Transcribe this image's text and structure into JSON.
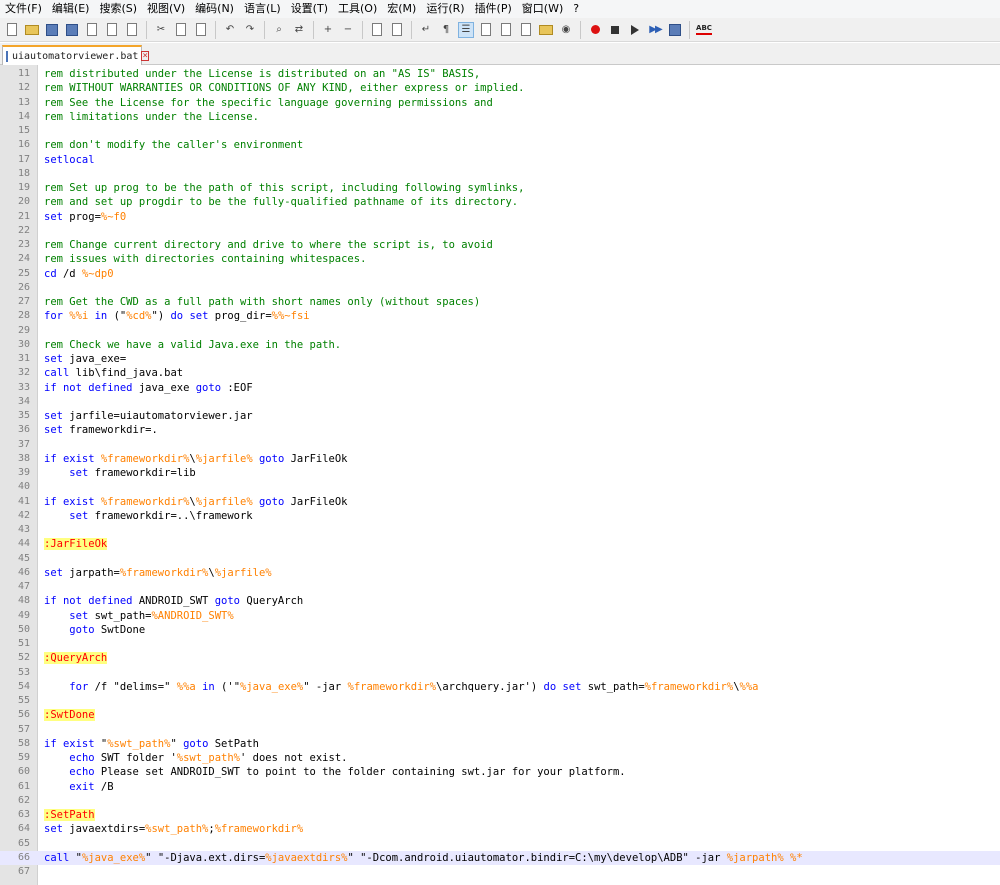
{
  "menu": [
    "文件(F)",
    "编辑(E)",
    "搜索(S)",
    "视图(V)",
    "编码(N)",
    "语言(L)",
    "设置(T)",
    "工具(O)",
    "宏(M)",
    "运行(R)",
    "插件(P)",
    "窗口(W)",
    "?"
  ],
  "toolbar": [
    {
      "name": "new-file-icon",
      "type": "doc"
    },
    {
      "name": "open-file-icon",
      "type": "folder"
    },
    {
      "name": "save-icon",
      "type": "disk"
    },
    {
      "name": "save-all-icon",
      "type": "disk"
    },
    {
      "name": "close-file-icon",
      "type": "doc"
    },
    {
      "name": "close-all-icon",
      "type": "doc"
    },
    {
      "name": "print-icon",
      "type": "doc"
    },
    {
      "type": "sep"
    },
    {
      "name": "cut-icon",
      "type": "glyph",
      "glyph": "✂"
    },
    {
      "name": "copy-icon",
      "type": "doc"
    },
    {
      "name": "paste-icon",
      "type": "doc"
    },
    {
      "type": "sep"
    },
    {
      "name": "undo-icon",
      "type": "glyph",
      "glyph": "↶"
    },
    {
      "name": "redo-icon",
      "type": "glyph",
      "glyph": "↷"
    },
    {
      "type": "sep"
    },
    {
      "name": "find-icon",
      "type": "glyph",
      "glyph": "⌕"
    },
    {
      "name": "replace-icon",
      "type": "glyph",
      "glyph": "⇄"
    },
    {
      "type": "sep"
    },
    {
      "name": "zoom-in-icon",
      "type": "glyph",
      "glyph": "+"
    },
    {
      "name": "zoom-out-icon",
      "type": "glyph",
      "glyph": "−"
    },
    {
      "type": "sep"
    },
    {
      "name": "sync-vertical-icon",
      "type": "doc"
    },
    {
      "name": "sync-horizontal-icon",
      "type": "doc"
    },
    {
      "type": "sep"
    },
    {
      "name": "word-wrap-icon",
      "type": "glyph",
      "glyph": "↵"
    },
    {
      "name": "show-all-characters-icon",
      "type": "glyph",
      "glyph": "¶"
    },
    {
      "name": "indent-guide-icon",
      "type": "glyph",
      "glyph": "☰",
      "active": true
    },
    {
      "name": "user-language-icon",
      "type": "doc"
    },
    {
      "name": "document-map-icon",
      "type": "doc"
    },
    {
      "name": "function-list-icon",
      "type": "doc"
    },
    {
      "name": "folder-as-workspace-icon",
      "type": "folder"
    },
    {
      "name": "monitoring-icon",
      "type": "glyph",
      "glyph": "◉"
    },
    {
      "type": "sep"
    },
    {
      "name": "record-macro-icon",
      "type": "rec"
    },
    {
      "name": "stop-recording-icon",
      "type": "stop"
    },
    {
      "name": "playback-icon",
      "type": "play"
    },
    {
      "name": "run-macro-multiple-icon",
      "type": "ffwd"
    },
    {
      "name": "save-macro-icon",
      "type": "disk"
    },
    {
      "type": "sep"
    },
    {
      "name": "spell-check-icon",
      "type": "abc",
      "glyph": "ABC"
    }
  ],
  "tab": {
    "title": "uiautomatorviewer.bat"
  },
  "lines": [
    {
      "n": 11,
      "t": [
        [
          "cmt",
          "rem distributed under the License is distributed on an \"AS IS\" BASIS,"
        ]
      ]
    },
    {
      "n": 12,
      "t": [
        [
          "cmt",
          "rem WITHOUT WARRANTIES OR CONDITIONS OF ANY KIND, either express or implied."
        ]
      ]
    },
    {
      "n": 13,
      "t": [
        [
          "cmt",
          "rem See the License for the specific language governing permissions and"
        ]
      ]
    },
    {
      "n": 14,
      "t": [
        [
          "cmt",
          "rem limitations under the License."
        ]
      ]
    },
    {
      "n": 15,
      "t": []
    },
    {
      "n": 16,
      "t": [
        [
          "cmt",
          "rem don't modify the caller's environment"
        ]
      ]
    },
    {
      "n": 17,
      "t": [
        [
          "kw",
          "setlocal"
        ]
      ]
    },
    {
      "n": 18,
      "t": []
    },
    {
      "n": 19,
      "t": [
        [
          "cmt",
          "rem Set up prog to be the path of this script, including following symlinks,"
        ]
      ]
    },
    {
      "n": 20,
      "t": [
        [
          "cmt",
          "rem and set up progdir to be the fully-qualified pathname of its directory."
        ]
      ]
    },
    {
      "n": 21,
      "t": [
        [
          "kw",
          "set"
        ],
        [
          "txt",
          " prog="
        ],
        [
          "var",
          "%~f0"
        ]
      ]
    },
    {
      "n": 22,
      "t": []
    },
    {
      "n": 23,
      "t": [
        [
          "cmt",
          "rem Change current directory and drive to where the script is, to avoid"
        ]
      ]
    },
    {
      "n": 24,
      "t": [
        [
          "cmt",
          "rem issues with directories containing whitespaces."
        ]
      ]
    },
    {
      "n": 25,
      "t": [
        [
          "kw",
          "cd"
        ],
        [
          "txt",
          " /d "
        ],
        [
          "var",
          "%~dp0"
        ]
      ]
    },
    {
      "n": 26,
      "t": []
    },
    {
      "n": 27,
      "t": [
        [
          "cmt",
          "rem Get the CWD as a full path with short names only (without spaces)"
        ]
      ]
    },
    {
      "n": 28,
      "t": [
        [
          "kw",
          "for"
        ],
        [
          "txt",
          " "
        ],
        [
          "var",
          "%%i"
        ],
        [
          "txt",
          " "
        ],
        [
          "kw",
          "in"
        ],
        [
          "txt",
          " (\""
        ],
        [
          "var",
          "%cd%"
        ],
        [
          "txt",
          "\") "
        ],
        [
          "kw",
          "do"
        ],
        [
          "txt",
          " "
        ],
        [
          "kw",
          "set"
        ],
        [
          "txt",
          " prog_dir="
        ],
        [
          "var",
          "%%~fsi"
        ]
      ]
    },
    {
      "n": 29,
      "t": []
    },
    {
      "n": 30,
      "t": [
        [
          "cmt",
          "rem Check we have a valid Java.exe in the path."
        ]
      ]
    },
    {
      "n": 31,
      "t": [
        [
          "kw",
          "set"
        ],
        [
          "txt",
          " java_exe="
        ]
      ]
    },
    {
      "n": 32,
      "t": [
        [
          "kw",
          "call"
        ],
        [
          "txt",
          " lib\\find_java.bat"
        ]
      ]
    },
    {
      "n": 33,
      "t": [
        [
          "kw",
          "if not defined"
        ],
        [
          "txt",
          " java_exe "
        ],
        [
          "kw",
          "goto"
        ],
        [
          "txt",
          " :EOF"
        ]
      ]
    },
    {
      "n": 34,
      "t": []
    },
    {
      "n": 35,
      "t": [
        [
          "kw",
          "set"
        ],
        [
          "txt",
          " jarfile=uiautomatorviewer.jar"
        ]
      ]
    },
    {
      "n": 36,
      "t": [
        [
          "kw",
          "set"
        ],
        [
          "txt",
          " frameworkdir=."
        ]
      ]
    },
    {
      "n": 37,
      "t": []
    },
    {
      "n": 38,
      "t": [
        [
          "kw",
          "if exist"
        ],
        [
          "txt",
          " "
        ],
        [
          "var",
          "%frameworkdir%"
        ],
        [
          "txt",
          "\\"
        ],
        [
          "var",
          "%jarfile%"
        ],
        [
          "txt",
          " "
        ],
        [
          "kw",
          "goto"
        ],
        [
          "txt",
          " JarFileOk"
        ]
      ]
    },
    {
      "n": 39,
      "t": [
        [
          "txt",
          "    "
        ],
        [
          "kw",
          "set"
        ],
        [
          "txt",
          " frameworkdir=lib"
        ]
      ]
    },
    {
      "n": 40,
      "t": []
    },
    {
      "n": 41,
      "t": [
        [
          "kw",
          "if exist"
        ],
        [
          "txt",
          " "
        ],
        [
          "var",
          "%frameworkdir%"
        ],
        [
          "txt",
          "\\"
        ],
        [
          "var",
          "%jarfile%"
        ],
        [
          "txt",
          " "
        ],
        [
          "kw",
          "goto"
        ],
        [
          "txt",
          " JarFileOk"
        ]
      ]
    },
    {
      "n": 42,
      "t": [
        [
          "txt",
          "    "
        ],
        [
          "kw",
          "set"
        ],
        [
          "txt",
          " frameworkdir=..\\framework"
        ]
      ]
    },
    {
      "n": 43,
      "t": []
    },
    {
      "n": 44,
      "t": [
        [
          "lbl",
          ":JarFileOk"
        ]
      ]
    },
    {
      "n": 45,
      "t": []
    },
    {
      "n": 46,
      "t": [
        [
          "kw",
          "set"
        ],
        [
          "txt",
          " jarpath="
        ],
        [
          "var",
          "%frameworkdir%"
        ],
        [
          "txt",
          "\\"
        ],
        [
          "var",
          "%jarfile%"
        ]
      ]
    },
    {
      "n": 47,
      "t": []
    },
    {
      "n": 48,
      "t": [
        [
          "kw",
          "if not defined"
        ],
        [
          "txt",
          " ANDROID_SWT "
        ],
        [
          "kw",
          "goto"
        ],
        [
          "txt",
          " QueryArch"
        ]
      ]
    },
    {
      "n": 49,
      "t": [
        [
          "txt",
          "    "
        ],
        [
          "kw",
          "set"
        ],
        [
          "txt",
          " swt_path="
        ],
        [
          "var",
          "%ANDROID_SWT%"
        ]
      ]
    },
    {
      "n": 50,
      "t": [
        [
          "txt",
          "    "
        ],
        [
          "kw",
          "goto"
        ],
        [
          "txt",
          " SwtDone"
        ]
      ]
    },
    {
      "n": 51,
      "t": []
    },
    {
      "n": 52,
      "t": [
        [
          "lbl",
          ":QueryArch"
        ]
      ]
    },
    {
      "n": 53,
      "t": []
    },
    {
      "n": 54,
      "t": [
        [
          "txt",
          "    "
        ],
        [
          "kw",
          "for"
        ],
        [
          "txt",
          " /f \"delims=\" "
        ],
        [
          "var",
          "%%a"
        ],
        [
          "txt",
          " "
        ],
        [
          "kw",
          "in"
        ],
        [
          "txt",
          " ('\""
        ],
        [
          "var",
          "%java_exe%"
        ],
        [
          "txt",
          "\" -jar "
        ],
        [
          "var",
          "%frameworkdir%"
        ],
        [
          "txt",
          "\\archquery.jar') "
        ],
        [
          "kw",
          "do"
        ],
        [
          "txt",
          " "
        ],
        [
          "kw",
          "set"
        ],
        [
          "txt",
          " swt_path="
        ],
        [
          "var",
          "%frameworkdir%"
        ],
        [
          "txt",
          "\\"
        ],
        [
          "var",
          "%%a"
        ]
      ]
    },
    {
      "n": 55,
      "t": []
    },
    {
      "n": 56,
      "t": [
        [
          "lbl",
          ":SwtDone"
        ]
      ]
    },
    {
      "n": 57,
      "t": []
    },
    {
      "n": 58,
      "t": [
        [
          "kw",
          "if exist"
        ],
        [
          "txt",
          " \""
        ],
        [
          "var",
          "%swt_path%"
        ],
        [
          "txt",
          "\" "
        ],
        [
          "kw",
          "goto"
        ],
        [
          "txt",
          " SetPath"
        ]
      ]
    },
    {
      "n": 59,
      "t": [
        [
          "txt",
          "    "
        ],
        [
          "kw",
          "echo"
        ],
        [
          "txt",
          " SWT folder '"
        ],
        [
          "var",
          "%swt_path%"
        ],
        [
          "txt",
          "' does not exist."
        ]
      ]
    },
    {
      "n": 60,
      "t": [
        [
          "txt",
          "    "
        ],
        [
          "kw",
          "echo"
        ],
        [
          "txt",
          " Please set ANDROID_SWT to point to the folder containing swt.jar for your platform."
        ]
      ]
    },
    {
      "n": 61,
      "t": [
        [
          "txt",
          "    "
        ],
        [
          "kw",
          "exit"
        ],
        [
          "txt",
          " /B"
        ]
      ]
    },
    {
      "n": 62,
      "t": []
    },
    {
      "n": 63,
      "t": [
        [
          "lbl",
          ":SetPath"
        ]
      ]
    },
    {
      "n": 64,
      "t": [
        [
          "kw",
          "set"
        ],
        [
          "txt",
          " javaextdirs="
        ],
        [
          "var",
          "%swt_path%"
        ],
        [
          "txt",
          ";"
        ],
        [
          "var",
          "%frameworkdir%"
        ]
      ]
    },
    {
      "n": 65,
      "t": []
    },
    {
      "n": 66,
      "current": true,
      "t": [
        [
          "kw",
          "call"
        ],
        [
          "txt",
          " \""
        ],
        [
          "var",
          "%java_exe%"
        ],
        [
          "txt",
          "\" \"-Djava.ext.dirs="
        ],
        [
          "var",
          "%javaextdirs%"
        ],
        [
          "txt",
          "\" \"-Dcom.android.uiautomator.bindir=C:\\my\\develop\\ADB\" -jar "
        ],
        [
          "var",
          "%jarpath%"
        ],
        [
          "txt",
          " "
        ],
        [
          "var",
          "%*"
        ]
      ]
    },
    {
      "n": 67,
      "t": []
    }
  ]
}
